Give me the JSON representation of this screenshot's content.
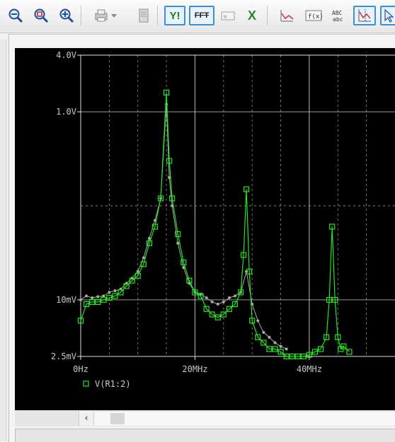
{
  "toolbar": {
    "buttons": [
      {
        "name": "zoom-out-icon"
      },
      {
        "name": "zoom-area-icon"
      },
      {
        "name": "zoom-fit-icon"
      },
      {
        "name": "print-setup-icon"
      },
      {
        "name": "print-preview-icon"
      },
      {
        "name": "axis-settings-icon",
        "text": "Y!"
      },
      {
        "name": "fft-icon",
        "text": "FFT"
      },
      {
        "name": "performance-analysis-icon"
      },
      {
        "name": "excel-export-icon",
        "text": "X"
      },
      {
        "name": "add-trace-icon"
      },
      {
        "name": "evaluate-measurement-icon",
        "text": "f(x)"
      },
      {
        "name": "text-label-icon",
        "text": "ABC abc"
      },
      {
        "name": "toggle-cursor-icon"
      },
      {
        "name": "select-pointer-icon"
      }
    ]
  },
  "colors": {
    "trace": "#22e61e",
    "second_trace": "#a9a9a9",
    "grid": "#d0d0d0",
    "axis_text": "#c8c8c8",
    "plot_bg": "#000000"
  },
  "chart_data": {
    "type": "line",
    "title": "",
    "xlabel": "",
    "ylabel": "",
    "x_ticks": [
      "0Hz",
      "20MHz",
      "40MHz"
    ],
    "y_ticks": [
      "4.0V",
      "1.0V",
      "10mV",
      "2.5mV"
    ],
    "xlim": [
      0,
      55
    ],
    "ylim": [
      0.0025,
      4.0
    ],
    "y_scale": "log",
    "grid": true,
    "legend": {
      "placement": "bottom-left",
      "entries": [
        "V(R1:2)"
      ]
    },
    "series": [
      {
        "name": "V(R1:2)",
        "x": [
          0,
          1,
          2,
          3,
          4,
          5,
          6,
          7,
          8,
          9,
          10,
          11,
          12,
          13,
          14,
          15,
          15.5,
          16,
          17,
          18,
          19,
          20,
          21,
          22,
          23,
          24,
          25,
          26,
          27,
          28,
          28.5,
          29,
          29.5,
          30,
          31,
          32,
          33,
          34,
          35,
          36,
          37,
          38,
          39,
          40,
          41,
          42,
          43,
          43.5,
          44,
          44.5,
          45,
          45.5,
          46,
          47
        ],
        "y": [
          0.006,
          0.009,
          0.0095,
          0.0095,
          0.01,
          0.0105,
          0.011,
          0.012,
          0.014,
          0.016,
          0.018,
          0.024,
          0.04,
          0.06,
          0.12,
          1.6,
          0.3,
          0.12,
          0.05,
          0.025,
          0.016,
          0.012,
          0.011,
          0.008,
          0.007,
          0.0065,
          0.007,
          0.008,
          0.009,
          0.012,
          0.03,
          0.15,
          0.02,
          0.006,
          0.004,
          0.0035,
          0.003,
          0.003,
          0.0028,
          0.0025,
          0.0025,
          0.0025,
          0.0025,
          0.0026,
          0.0028,
          0.003,
          0.004,
          0.01,
          0.06,
          0.01,
          0.004,
          0.003,
          0.0032,
          0.0028
        ]
      },
      {
        "name": "",
        "x": [
          0,
          1,
          2,
          3,
          4,
          5,
          6,
          7,
          8,
          9,
          10,
          11,
          12,
          13,
          14,
          15,
          15.5,
          16,
          17,
          18,
          19,
          20,
          21,
          22,
          23,
          24,
          25,
          26,
          27,
          28,
          29,
          30,
          31,
          32,
          33,
          34,
          35,
          36
        ],
        "y": [
          0.01,
          0.011,
          0.0105,
          0.0108,
          0.011,
          0.012,
          0.0125,
          0.013,
          0.015,
          0.017,
          0.02,
          0.028,
          0.045,
          0.07,
          0.12,
          1.2,
          0.2,
          0.1,
          0.04,
          0.022,
          0.015,
          0.012,
          0.0115,
          0.0105,
          0.0095,
          0.009,
          0.0095,
          0.0105,
          0.011,
          0.012,
          0.02,
          0.009,
          0.006,
          0.0045,
          0.004,
          0.0035,
          0.0032,
          0.003
        ]
      }
    ]
  },
  "scrollbar": {
    "left_arrow": "‹"
  }
}
